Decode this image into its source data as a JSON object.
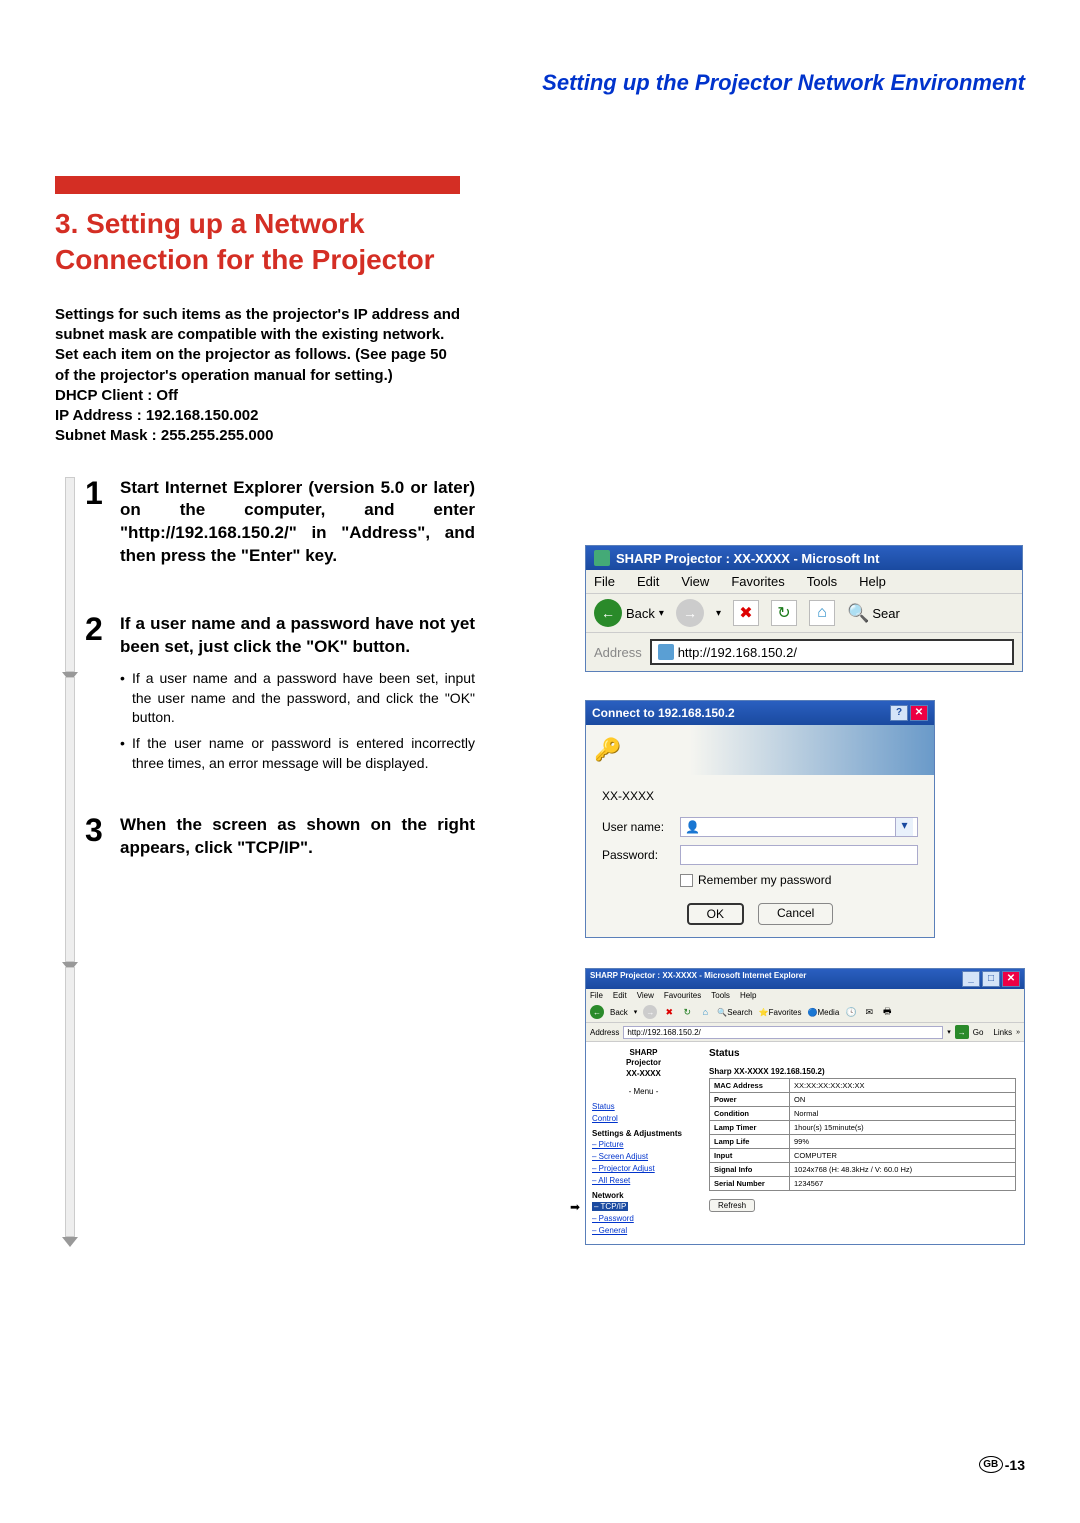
{
  "header": "Setting up the Projector Network Environment",
  "section_title": "3. Setting up a Network Connection for the Projector",
  "intro": "Settings for such items as the projector's IP address and subnet mask are compatible with the existing network.\nSet each item on the projector as follows. (See page 50 of the projector's operation manual for setting.)\nDHCP Client : Off\nIP Address : 192.168.150.002\nSubnet Mask : 255.255.255.000",
  "steps": [
    {
      "num": "1",
      "heading": "Start Internet Explorer (version 5.0 or later) on the computer, and enter \"http://192.168.150.2/\" in \"Address\", and then press the \"Enter\" key.",
      "bullets": []
    },
    {
      "num": "2",
      "heading": "If a user name and a password have not yet been set, just click the \"OK\" button.",
      "bullets": [
        "If a user name and a password have been set, input the user name and the password, and click the \"OK\" button.",
        "If the user name or password is entered incorrectly three times, an error message will be displayed."
      ]
    },
    {
      "num": "3",
      "heading": "When the screen as shown on the right appears, click \"TCP/IP\".",
      "bullets": []
    }
  ],
  "ie": {
    "title": "SHARP Projector : XX-XXXX - Microsoft Int",
    "menu": [
      "File",
      "Edit",
      "View",
      "Favorites",
      "Tools",
      "Help"
    ],
    "back": "Back",
    "search": "Sear",
    "addr_label": "Address",
    "addr_value": "http://192.168.150.2/"
  },
  "login": {
    "title": "Connect to 192.168.150.2",
    "model": "XX-XXXX",
    "user_label": "User name:",
    "pass_label": "Password:",
    "remember": "Remember my password",
    "ok": "OK",
    "cancel": "Cancel"
  },
  "status": {
    "title": "SHARP Projector : XX-XXXX - Microsoft Internet Explorer",
    "menu": [
      "File",
      "Edit",
      "View",
      "Favourites",
      "Tools",
      "Help"
    ],
    "back": "Back",
    "search": "Search",
    "fav": "Favorites",
    "media": "Media",
    "addr_label": "Address",
    "addr_value": "http://192.168.150.2/",
    "go": "Go",
    "links": "Links",
    "sidebar": {
      "brand1": "SHARP",
      "brand2": "Projector",
      "brand3": "XX-XXXX",
      "menu_label": "- Menu -",
      "status": "Status",
      "control": "Control",
      "settings_hdr": "Settings & Adjustments",
      "picture": "– Picture",
      "screen": "– Screen Adjust",
      "projector": "– Projector Adjust",
      "allreset": "– All Reset",
      "network_hdr": "Network",
      "tcpip": "– TCP/IP",
      "password": "– Password",
      "general": "– General"
    },
    "main": {
      "title": "Status",
      "header": "Sharp XX-XXXX  192.168.150.2)",
      "rows": [
        {
          "k": "MAC Address",
          "v": "XX:XX:XX:XX:XX:XX"
        },
        {
          "k": "Power",
          "v": "ON"
        },
        {
          "k": "Condition",
          "v": "Normal"
        },
        {
          "k": "Lamp Timer",
          "v": "1hour(s) 15minute(s)"
        },
        {
          "k": "Lamp Life",
          "v": "99%"
        },
        {
          "k": "Input",
          "v": "COMPUTER"
        },
        {
          "k": "Signal Info",
          "v": "1024x768 (H: 48.3kHz / V: 60.0 Hz)"
        },
        {
          "k": "Serial Number",
          "v": "1234567"
        }
      ],
      "refresh": "Refresh"
    }
  },
  "footer": {
    "gb": "GB",
    "page": "-13"
  }
}
